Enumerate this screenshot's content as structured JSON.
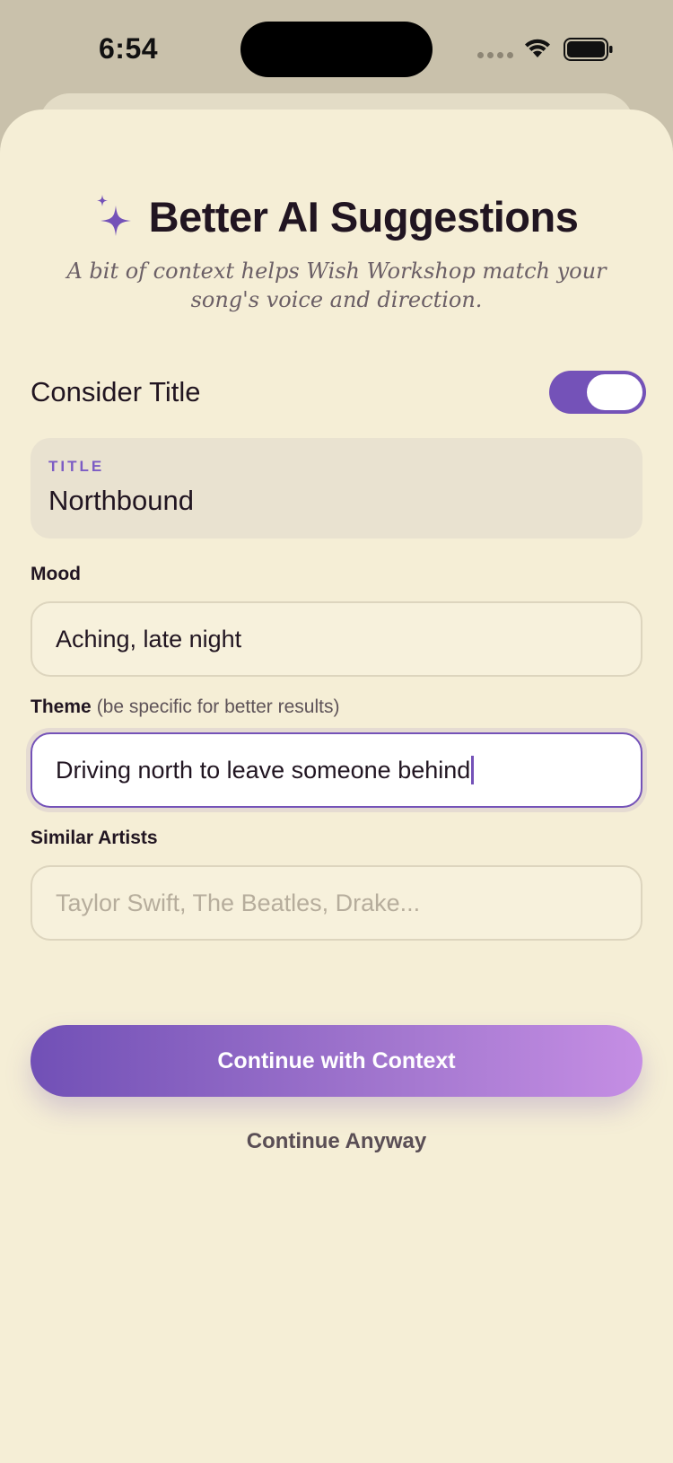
{
  "status": {
    "time": "6:54"
  },
  "header": {
    "title": "Better AI Suggestions",
    "subtitle": "A bit of context helps Wish Workshop match your song's voice and direction."
  },
  "consider_title": {
    "label": "Consider Title",
    "enabled": true
  },
  "title_field": {
    "label": "TITLE",
    "value": "Northbound"
  },
  "mood": {
    "label": "Mood",
    "value": "Aching, late night"
  },
  "theme": {
    "label": "Theme",
    "hint": "(be specific for better results)",
    "value": "Driving north to leave someone behind"
  },
  "similar_artists": {
    "label": "Similar Artists",
    "placeholder": "Taylor Swift, The Beatles, Drake..."
  },
  "actions": {
    "primary": "Continue with Context",
    "secondary": "Continue Anyway"
  },
  "colors": {
    "accent": "#7452b8",
    "background": "#f5eed6"
  },
  "icons": {
    "title": "sparkles-icon"
  }
}
